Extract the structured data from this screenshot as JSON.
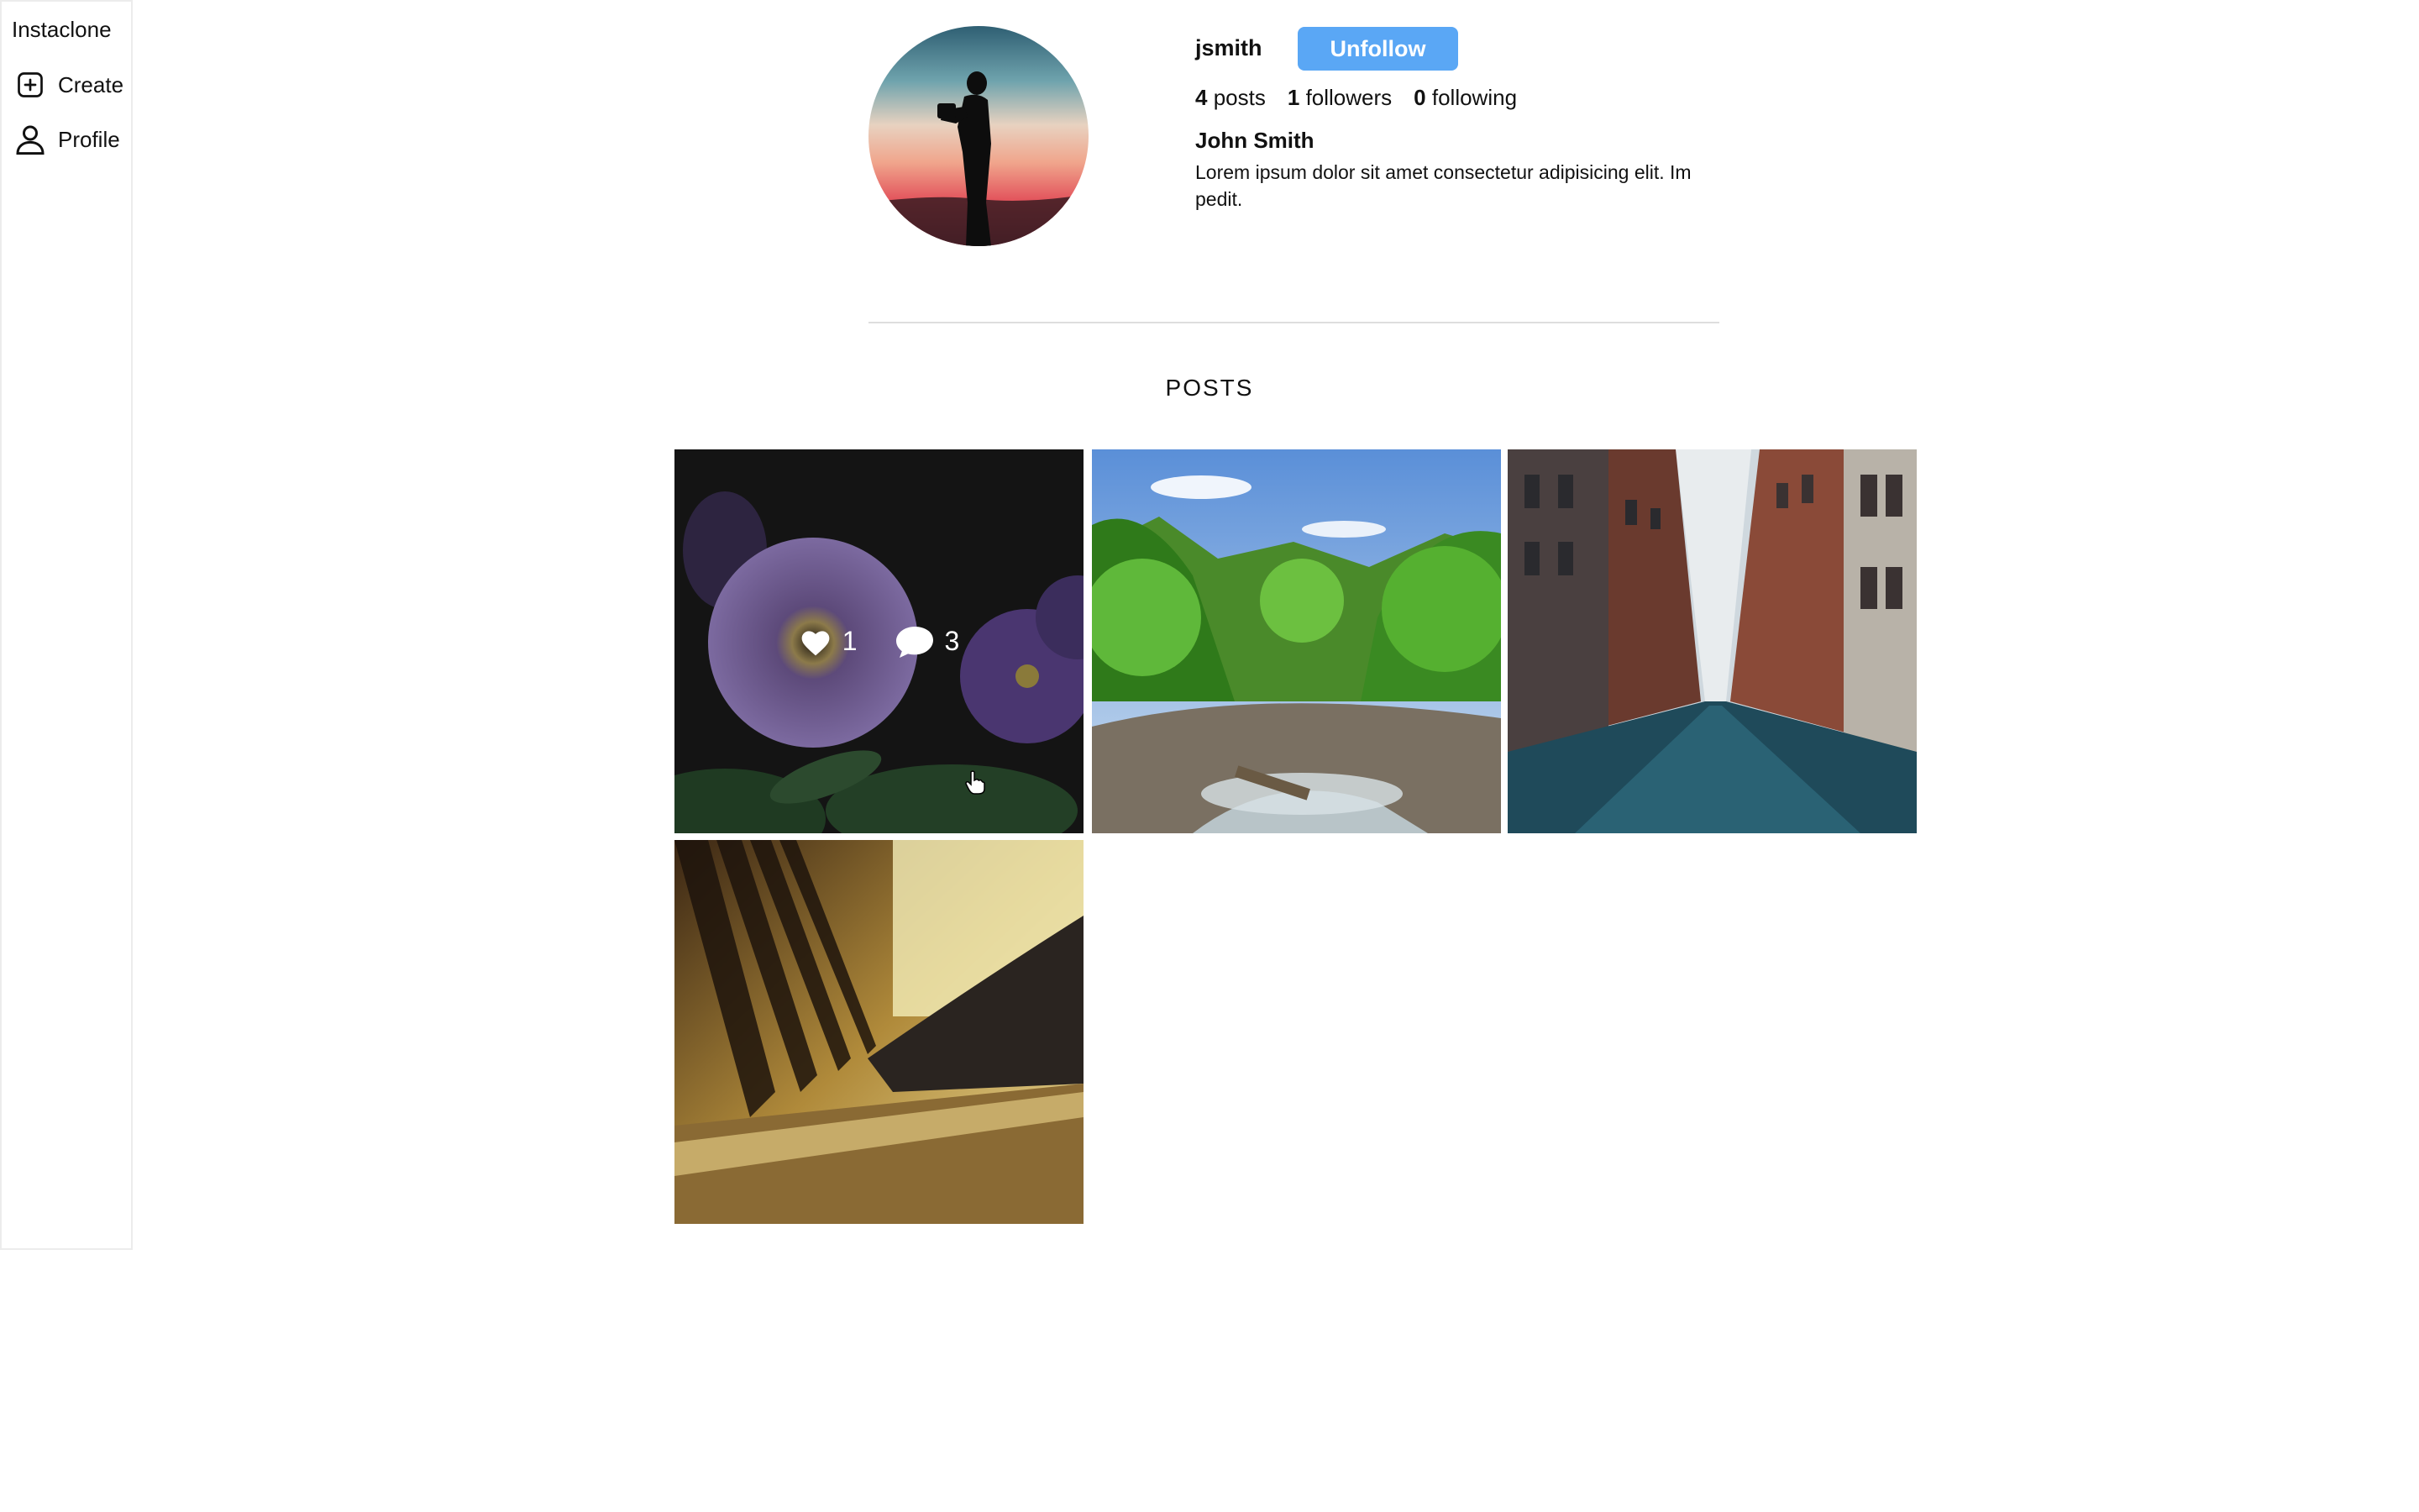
{
  "app": {
    "brand": "Instaclone"
  },
  "sidebar": {
    "items": [
      {
        "label": "Create",
        "icon": "plus-square-icon"
      },
      {
        "label": "Profile",
        "icon": "user-icon"
      }
    ]
  },
  "profile": {
    "username": "jsmith",
    "follow_button_label": "Unfollow",
    "stats": {
      "posts_count": "4",
      "posts_label": "posts",
      "followers_count": "1",
      "followers_label": "followers",
      "following_count": "0",
      "following_label": "following"
    },
    "full_name": "John Smith",
    "bio": "Lorem ipsum dolor sit amet consectetur adipisicing elit. Im pedit."
  },
  "posts_section": {
    "title": "POSTS",
    "posts": [
      {
        "subject": "purple petunia flowers",
        "likes": "1",
        "comments": "3",
        "hovered": true
      },
      {
        "subject": "green forest with rocky stream"
      },
      {
        "subject": "city street with brick buildings"
      },
      {
        "subject": "piano keys in warm light"
      }
    ]
  },
  "colors": {
    "accent": "#5aa7f5"
  }
}
